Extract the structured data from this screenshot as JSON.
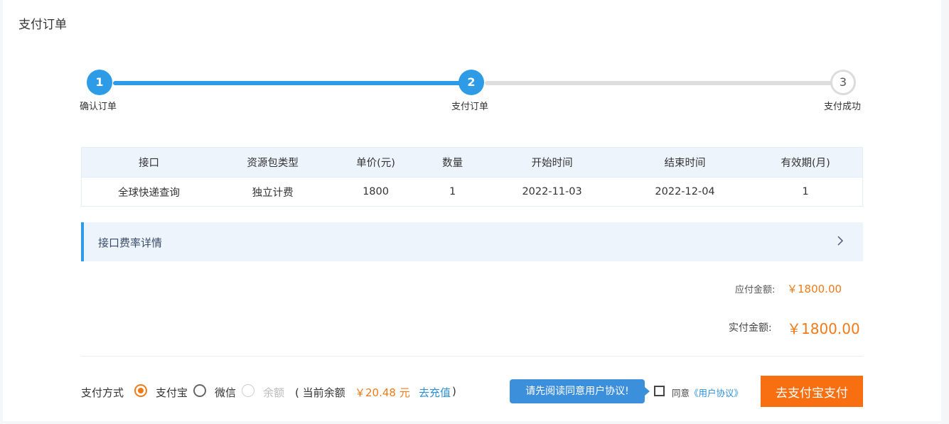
{
  "page": {
    "title": "支付订单"
  },
  "steps": [
    {
      "number": "1",
      "label": "确认订单",
      "state": "done"
    },
    {
      "number": "2",
      "label": "支付订单",
      "state": "current"
    },
    {
      "number": "3",
      "label": "支付成功",
      "state": "todo"
    }
  ],
  "order_table": {
    "headers": [
      "接口",
      "资源包类型",
      "单价(元)",
      "数量",
      "开始时间",
      "结束时间",
      "有效期(月)"
    ],
    "rows": [
      [
        "全球快递查询",
        "独立计费",
        "1800",
        "1",
        "2022-11-03",
        "2022-12-04",
        "1"
      ]
    ]
  },
  "rate_details": {
    "label": "接口费率详情"
  },
  "amounts": {
    "due_label": "应付金额:",
    "due_value": "￥1800.00",
    "paid_label": "实付金额:",
    "paid_value": "￥1800.00"
  },
  "payment": {
    "label": "支付方式",
    "options": [
      {
        "label": "支付宝",
        "checked": true
      },
      {
        "label": "微信",
        "checked": false
      },
      {
        "label": "余额",
        "checked": false,
        "disabled": true
      }
    ],
    "balance_prefix": "( 当前余额",
    "balance_value": "￥20.48 元",
    "recharge_label": "去充值",
    "balance_suffix": ")"
  },
  "agreement": {
    "tooltip": "请先阅读同意用户协议!",
    "agree_text": "同意",
    "link_text": "《用户协议》"
  },
  "pay_button": {
    "label": "去支付宝支付"
  },
  "colors": {
    "accent": "#2d9be5",
    "orange": "#f07a1a",
    "button": "#f76f10"
  }
}
